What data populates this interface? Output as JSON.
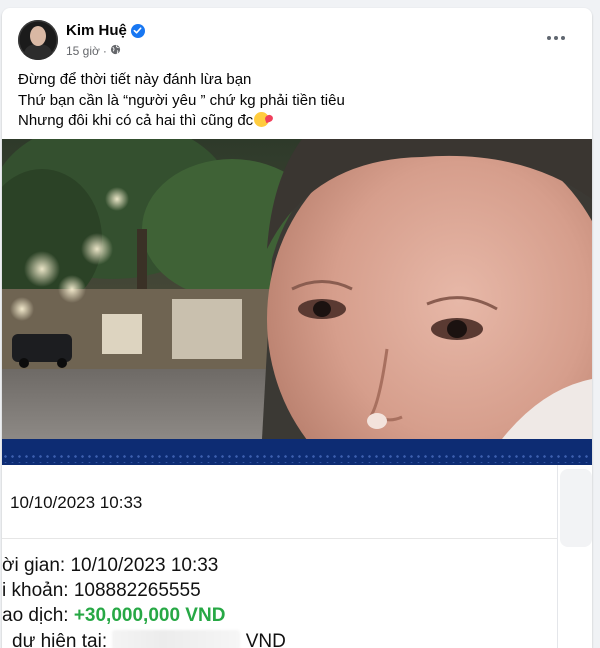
{
  "post": {
    "author": "Kim Huệ",
    "time": "15 giờ",
    "privacy_icon": "globe-icon",
    "verified_icon": "verified-badge-icon",
    "more_icon": "more-options-icon",
    "caption": {
      "line1": "Đừng để thời tiết này đánh lừa bạn",
      "line2": "Thứ bạn cần là “người yêu ” chứ kg phải tiền tiêu",
      "line3": "Nhưng đôi khi có cả hai thì cũng đc",
      "emoji": "smiling-face-with-hearts-emoji"
    }
  },
  "receipt": {
    "date_header": "10/10/2023 10:33",
    "time_label": "ời gian:",
    "time_value": "10/10/2023 10:33",
    "account_label": "i khoản:",
    "account_value": "108882265555",
    "transaction_label": "ao dịch:",
    "transaction_value": "+30,000,000 VND",
    "balance_label": "dư hiện tại:",
    "balance_currency": "VND"
  },
  "colors": {
    "accent": "#1877f2",
    "amount_green": "#27a845",
    "bank_band": "#0d2c73",
    "meta_gray": "#65676b"
  }
}
